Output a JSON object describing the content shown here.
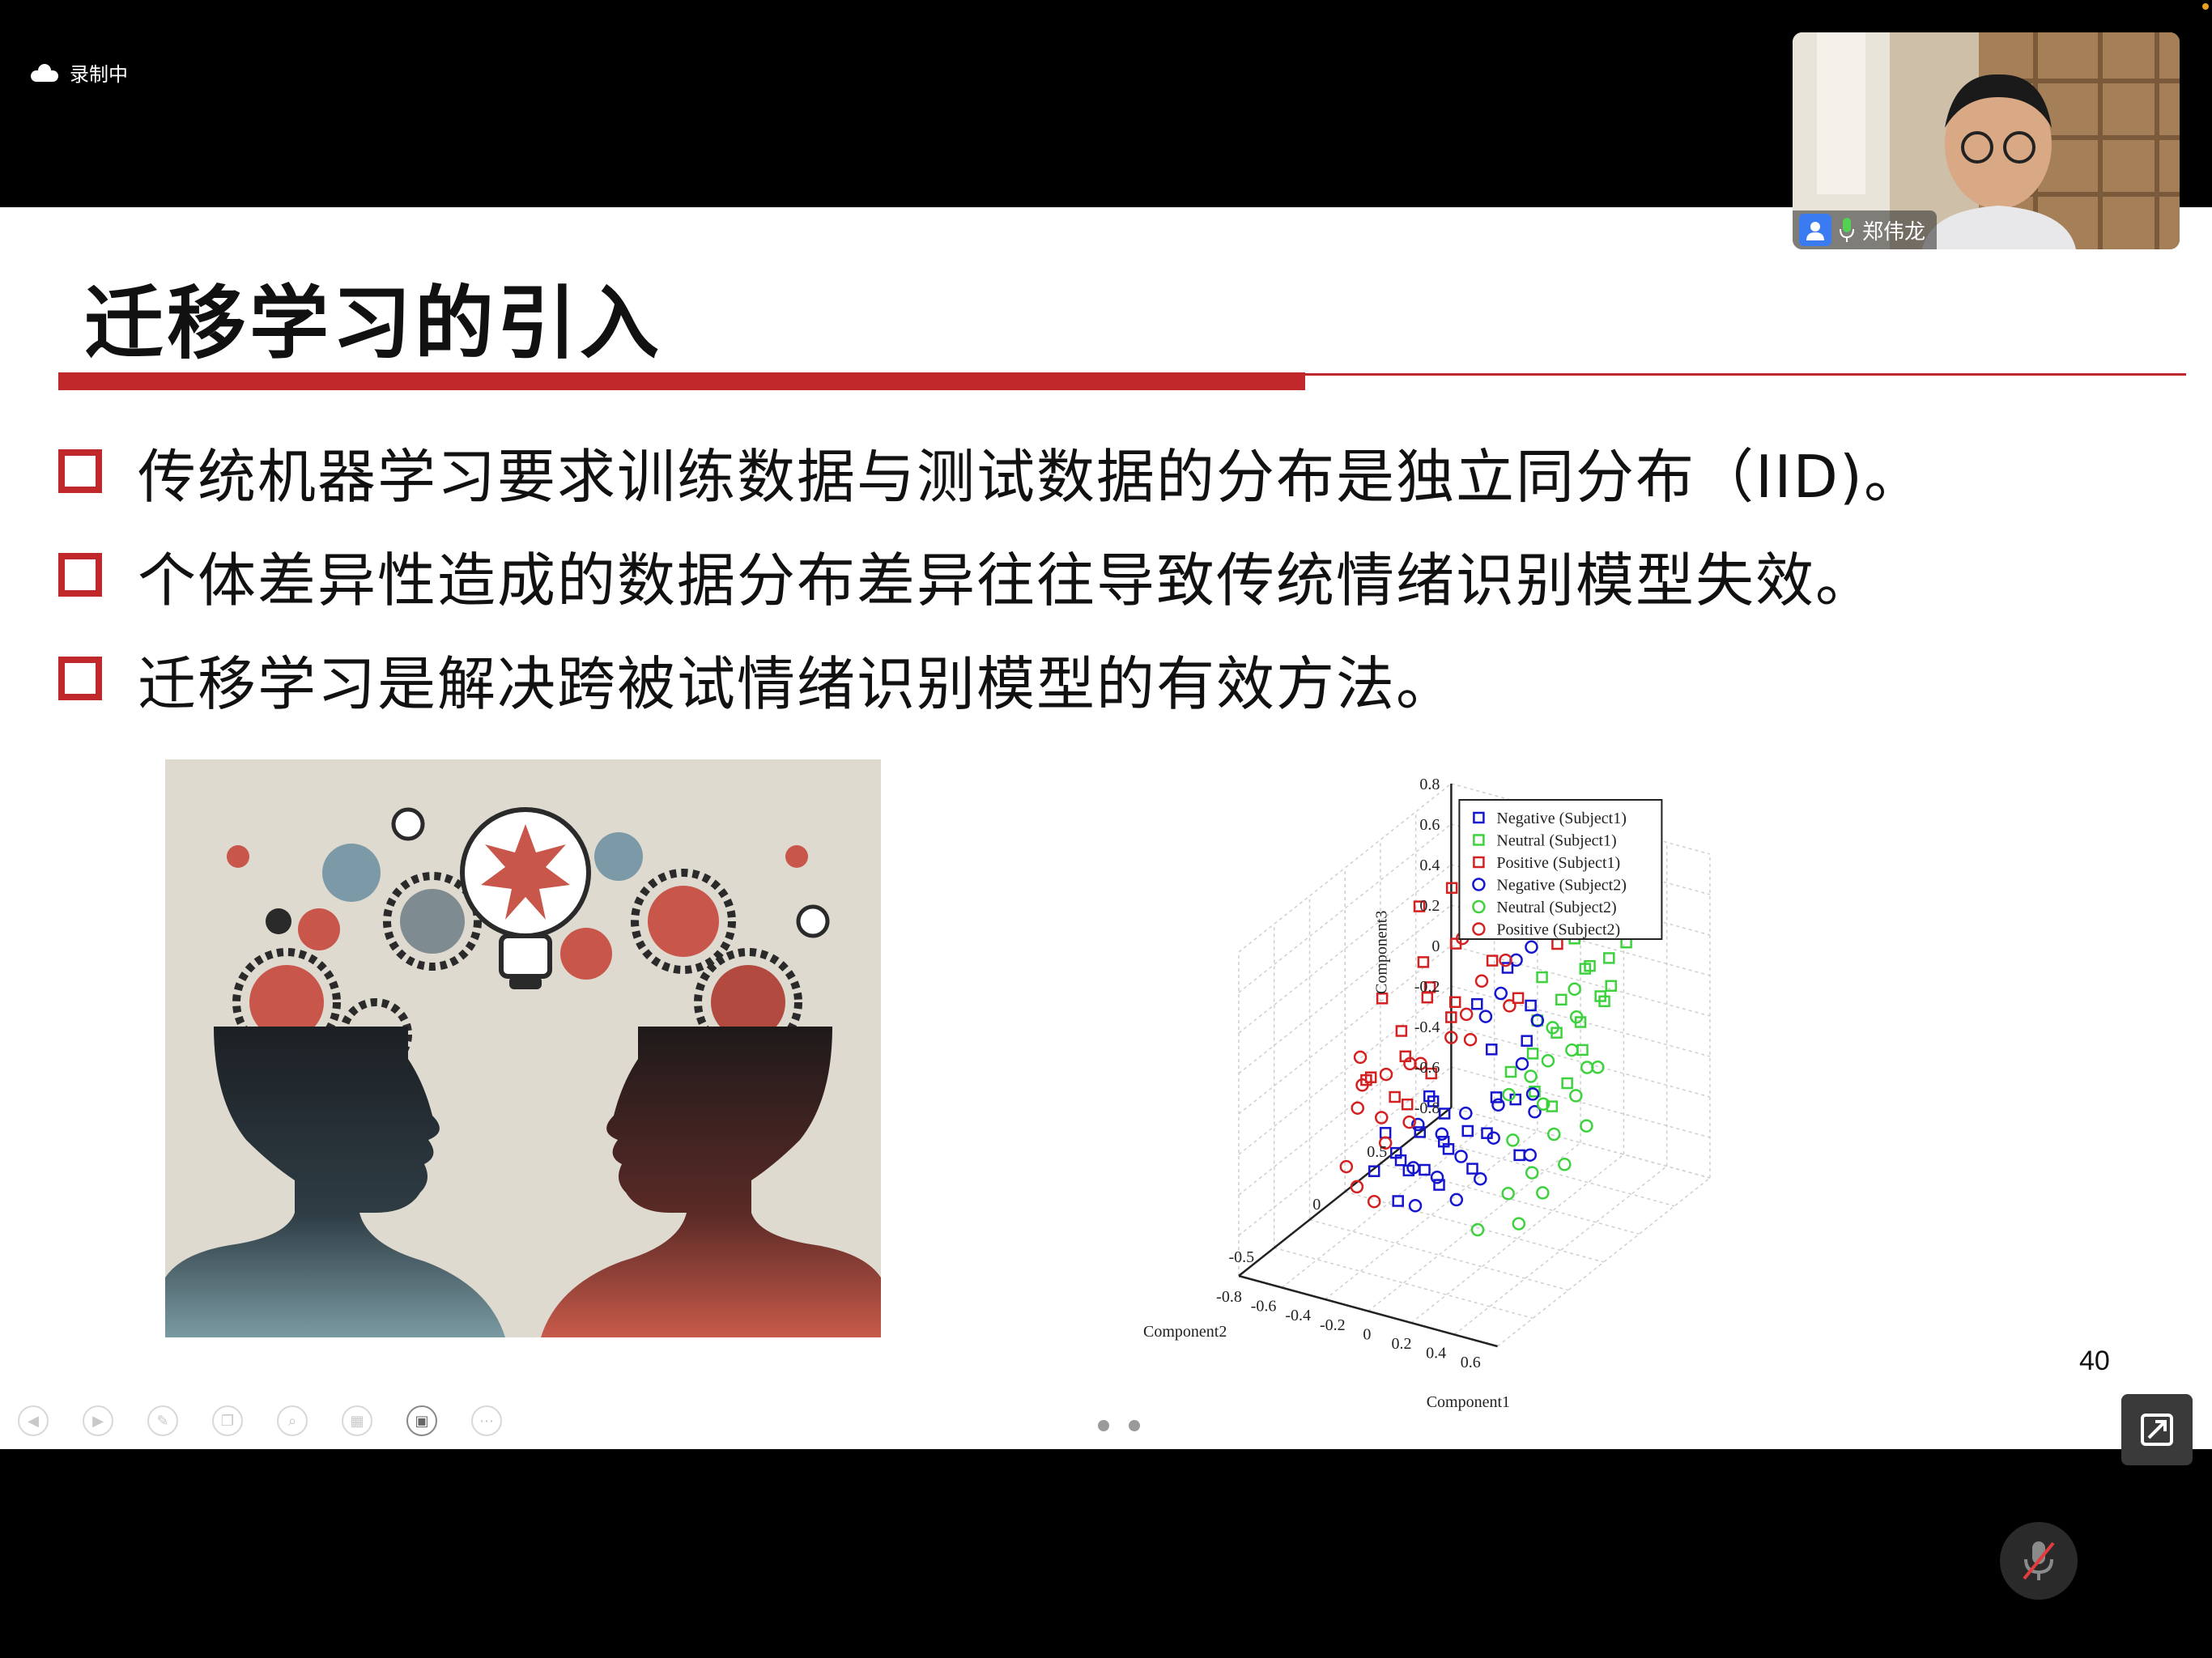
{
  "recording": {
    "label": "录制中"
  },
  "webcam": {
    "participant_name": "郑伟龙"
  },
  "slide": {
    "title": "迁移学习的引入",
    "bullets": [
      "传统机器学习要求训练数据与测试数据的分布是独立同分布（IID)。",
      "个体差异性造成的数据分布差异往往导致传统情绪识别模型失效。",
      "迁移学习是解决跨被试情绪识别模型的有效方法。"
    ],
    "page_number": "40",
    "accent_color": "#c0282b"
  },
  "chart_data": {
    "type": "scatter",
    "title": "",
    "xlabel": "Component1",
    "ylabel": "Component2",
    "zlabel": "Component3",
    "x_ticks": [
      "-0.8",
      "-0.6",
      "-0.4",
      "-0.2",
      "0",
      "0.2",
      "0.4",
      "0.6"
    ],
    "y_ticks": [
      "-0.5",
      "0",
      "0.5"
    ],
    "z_ticks": [
      "-0.8",
      "-0.6",
      "-0.4",
      "-0.2",
      "0",
      "0.2",
      "0.4",
      "0.6",
      "0.8"
    ],
    "xlim": [
      -0.8,
      0.7
    ],
    "ylim": [
      -0.8,
      0.8
    ],
    "zlim": [
      -0.8,
      0.8
    ],
    "legend": [
      "Negative (Subject1)",
      "Neutral (Subject1)",
      "Positive (Subject1)",
      "Negative (Subject2)",
      "Neutral (Subject2)",
      "Positive (Subject2)"
    ],
    "legend_position": "top-left",
    "grid": true,
    "series": [
      {
        "name": "Negative (Subject1)",
        "marker": "square",
        "color": "#1515d0",
        "points": [
          [
            -0.45,
            -0.15,
            -0.35
          ],
          [
            -0.4,
            -0.1,
            -0.5
          ],
          [
            -0.35,
            -0.2,
            -0.4
          ],
          [
            -0.3,
            -0.05,
            -0.55
          ],
          [
            -0.25,
            -0.15,
            -0.3
          ],
          [
            -0.2,
            0.0,
            -0.45
          ],
          [
            -0.15,
            -0.1,
            -0.35
          ],
          [
            -0.1,
            -0.2,
            -0.5
          ],
          [
            -0.3,
            -0.25,
            -0.6
          ],
          [
            -0.35,
            0.05,
            -0.25
          ],
          [
            -0.2,
            -0.3,
            -0.4
          ],
          [
            -0.05,
            -0.05,
            -0.3
          ],
          [
            0.0,
            0.1,
            -0.2
          ],
          [
            0.05,
            0.0,
            0.1
          ],
          [
            -0.15,
            0.15,
            0.2
          ],
          [
            0.1,
            -0.1,
            -0.25
          ],
          [
            0.15,
            0.05,
            -0.15
          ],
          [
            -0.25,
            -0.05,
            -0.2
          ],
          [
            -0.4,
            -0.3,
            -0.45
          ],
          [
            -0.1,
            0.05,
            -0.55
          ],
          [
            0.2,
            0.1,
            0.3
          ],
          [
            0.1,
            0.2,
            0.05
          ],
          [
            -0.05,
            0.25,
            0.35
          ],
          [
            0.25,
            -0.05,
            -0.35
          ],
          [
            -0.3,
            0.1,
            -0.35
          ]
        ]
      },
      {
        "name": "Neutral (Subject1)",
        "marker": "square",
        "color": "#3dd23d",
        "points": [
          [
            0.3,
            0.2,
            0.3
          ],
          [
            0.35,
            0.1,
            0.2
          ],
          [
            0.4,
            0.25,
            0.45
          ],
          [
            0.45,
            0.15,
            0.25
          ],
          [
            0.5,
            0.3,
            0.5
          ],
          [
            0.55,
            0.2,
            0.35
          ],
          [
            0.6,
            0.3,
            0.6
          ],
          [
            0.25,
            0.05,
            0.1
          ],
          [
            0.2,
            0.15,
            0.2
          ],
          [
            0.3,
            0.3,
            0.55
          ],
          [
            0.35,
            0.35,
            0.4
          ],
          [
            0.45,
            0.05,
            0.0
          ],
          [
            0.5,
            0.1,
            0.15
          ],
          [
            0.4,
            0.0,
            -0.1
          ],
          [
            0.55,
            0.25,
            0.4
          ],
          [
            0.65,
            0.35,
            0.7
          ],
          [
            0.15,
            0.25,
            0.35
          ],
          [
            0.3,
            0.0,
            -0.05
          ],
          [
            0.2,
            -0.05,
            0.05
          ],
          [
            0.45,
            0.3,
            0.3
          ]
        ]
      },
      {
        "name": "Positive (Subject1)",
        "marker": "square",
        "color": "#d42020",
        "points": [
          [
            -0.6,
            0.3,
            0.5
          ],
          [
            -0.5,
            0.2,
            0.3
          ],
          [
            -0.45,
            0.35,
            0.6
          ],
          [
            -0.4,
            0.1,
            0.2
          ],
          [
            -0.35,
            0.25,
            0.4
          ],
          [
            -0.3,
            0.15,
            0.1
          ],
          [
            -0.25,
            0.3,
            0.55
          ],
          [
            -0.2,
            0.05,
            0.25
          ],
          [
            -0.55,
            0.1,
            0.0
          ],
          [
            -0.5,
            0.25,
            0.15
          ],
          [
            -0.65,
            0.0,
            -0.2
          ],
          [
            -0.6,
            -0.1,
            -0.15
          ],
          [
            -0.55,
            0.05,
            -0.3
          ],
          [
            -0.1,
            0.2,
            0.4
          ],
          [
            0.0,
            0.3,
            0.6
          ],
          [
            0.1,
            0.35,
            0.65
          ],
          [
            -0.35,
            0.4,
            0.75
          ],
          [
            -0.45,
            0.0,
            -0.05
          ],
          [
            -0.7,
            0.15,
            0.1
          ],
          [
            -0.4,
            -0.05,
            -0.25
          ],
          [
            0.05,
            0.2,
            0.25
          ],
          [
            0.2,
            0.3,
            0.5
          ],
          [
            -0.3,
            0.0,
            -0.1
          ],
          [
            -0.15,
            0.35,
            0.5
          ]
        ]
      },
      {
        "name": "Negative (Subject2)",
        "marker": "circle",
        "color": "#1515d0",
        "points": [
          [
            -0.3,
            -0.1,
            -0.3
          ],
          [
            -0.25,
            -0.2,
            -0.45
          ],
          [
            -0.2,
            -0.05,
            -0.35
          ],
          [
            -0.15,
            -0.15,
            -0.5
          ],
          [
            -0.1,
            0.0,
            -0.25
          ],
          [
            -0.05,
            -0.1,
            -0.4
          ],
          [
            0.0,
            -0.2,
            -0.55
          ],
          [
            0.05,
            0.05,
            -0.2
          ],
          [
            0.1,
            -0.05,
            -0.3
          ],
          [
            0.15,
            0.1,
            0.0
          ],
          [
            0.2,
            0.15,
            0.2
          ],
          [
            0.25,
            0.05,
            -0.1
          ],
          [
            -0.05,
            0.2,
            0.25
          ],
          [
            0.0,
            0.25,
            0.4
          ],
          [
            -0.1,
            0.15,
            0.15
          ],
          [
            0.3,
            0.0,
            -0.15
          ],
          [
            0.35,
            -0.1,
            -0.3
          ],
          [
            -0.2,
            -0.25,
            -0.6
          ],
          [
            0.1,
            -0.15,
            -0.45
          ],
          [
            0.05,
            0.3,
            0.45
          ]
        ]
      },
      {
        "name": "Neutral (Subject2)",
        "marker": "circle",
        "color": "#3dd23d",
        "points": [
          [
            0.3,
            0.1,
            0.05
          ],
          [
            0.35,
            0.0,
            -0.1
          ],
          [
            0.4,
            0.15,
            0.1
          ],
          [
            0.45,
            -0.05,
            -0.2
          ],
          [
            0.5,
            0.05,
            -0.05
          ],
          [
            0.55,
            -0.1,
            -0.3
          ],
          [
            0.25,
            0.2,
            0.15
          ],
          [
            0.2,
            0.1,
            -0.05
          ],
          [
            0.4,
            -0.15,
            -0.35
          ],
          [
            0.3,
            -0.2,
            -0.45
          ],
          [
            0.45,
            0.2,
            0.0
          ],
          [
            0.35,
            0.25,
            0.2
          ],
          [
            0.5,
            -0.2,
            -0.4
          ],
          [
            0.6,
            0.0,
            -0.15
          ],
          [
            0.15,
            0.0,
            -0.1
          ],
          [
            0.25,
            -0.1,
            -0.25
          ],
          [
            0.4,
            -0.25,
            -0.55
          ],
          [
            0.2,
            -0.3,
            -0.6
          ],
          [
            0.55,
            0.15,
            0.05
          ],
          [
            0.3,
            0.3,
            0.3
          ]
        ]
      },
      {
        "name": "Positive (Subject2)",
        "marker": "circle",
        "color": "#d42020",
        "points": [
          [
            -0.7,
            0.0,
            -0.25
          ],
          [
            -0.65,
            -0.1,
            -0.3
          ],
          [
            -0.6,
            0.05,
            -0.2
          ],
          [
            -0.55,
            -0.05,
            -0.35
          ],
          [
            -0.5,
            0.1,
            -0.15
          ],
          [
            -0.45,
            -0.15,
            -0.4
          ],
          [
            -0.4,
            0.05,
            -0.1
          ],
          [
            -0.35,
            -0.1,
            -0.3
          ],
          [
            -0.3,
            0.15,
            0.0
          ],
          [
            -0.25,
            0.2,
            0.1
          ],
          [
            -0.2,
            0.25,
            0.25
          ],
          [
            -0.15,
            0.1,
            0.05
          ],
          [
            -0.1,
            0.3,
            0.35
          ],
          [
            -0.05,
            0.35,
            0.5
          ],
          [
            0.0,
            0.2,
            0.2
          ],
          [
            -0.5,
            -0.3,
            -0.55
          ],
          [
            -0.6,
            -0.25,
            -0.5
          ],
          [
            -0.4,
            -0.3,
            -0.6
          ],
          [
            -0.75,
            0.05,
            -0.15
          ],
          [
            -0.35,
            0.3,
            0.4
          ]
        ]
      }
    ]
  }
}
